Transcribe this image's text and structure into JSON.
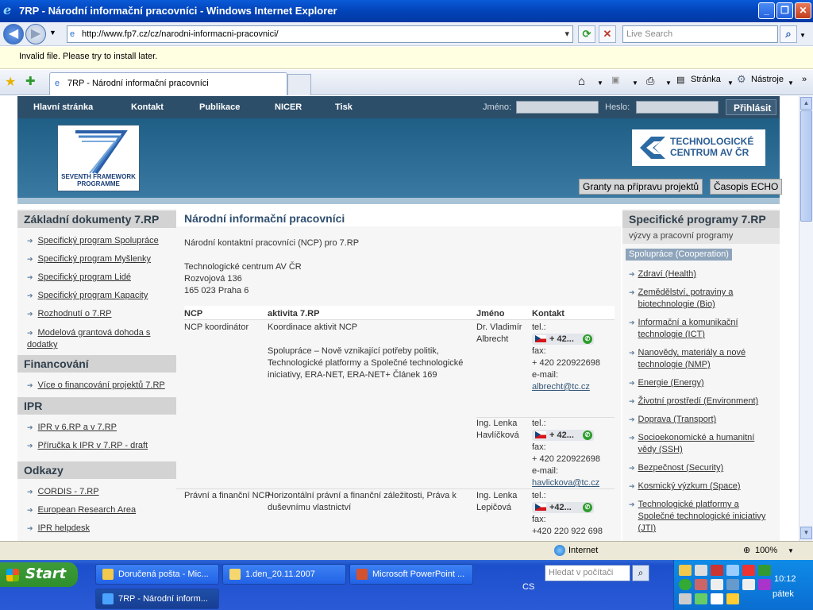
{
  "window": {
    "title": "7RP - Národní informační pracovníci - Windows Internet Explorer"
  },
  "browser": {
    "url": "http://www.fp7.cz/cz/narodni-informacni-pracovnici/",
    "search_placeholder": "Live Search",
    "info_bar": "Invalid file. Please try to install later.",
    "tab_title": "7RP - Národní informační pracovníci",
    "toolbar": {
      "page": "Stránka",
      "tools": "Nástroje"
    }
  },
  "page": {
    "nav": [
      "Hlavní stránka",
      "Kontakt",
      "Publikace",
      "NICER",
      "Tisk"
    ],
    "login": {
      "name_label": "Jméno:",
      "pass_label": "Heslo:",
      "submit": "Přihlásit"
    },
    "logo_left": {
      "line1": "SEVENTH FRAMEWORK",
      "line2": "PROGRAMME"
    },
    "logo_right": {
      "line1": "TECHNOLOGICKÉ",
      "line2": "CENTRUM AV ČR"
    },
    "header_buttons": [
      "Granty na přípravu projektů",
      "Časopis ECHO"
    ],
    "left": {
      "sections": [
        {
          "title": "Základní dokumenty 7.RP",
          "links": [
            "Specifický program Spolupráce",
            "Specifický program Myšlenky",
            "Specifický program Lidé",
            "Specifický program Kapacity",
            "Rozhodnutí o 7.RP",
            "Modelová grantová dohoda s dodatky"
          ]
        },
        {
          "title": "Financování",
          "links": [
            "Více o financování projektů 7.RP"
          ]
        },
        {
          "title": "IPR",
          "links": [
            "IPR v 6.RP a v 7.RP",
            "Příručka k IPR v 7.RP - draft"
          ]
        },
        {
          "title": "Odkazy",
          "links": [
            "CORDIS - 7.RP",
            "European Research Area",
            "IPR helpdesk"
          ]
        }
      ]
    },
    "main": {
      "title": "Národní informační pracovníci",
      "intro": "Národní kontaktní pracovníci (NCP) pro 7.RP",
      "address": [
        "Technologické centrum AV ČR",
        "Rozvojová 136",
        "165 023 Praha 6"
      ],
      "table_headers": [
        "NCP",
        "aktivita 7.RP",
        "Jméno",
        "Kontakt"
      ],
      "rows": [
        {
          "ncp": "NCP koordinátor",
          "activity": "Koordinace aktivit NCP",
          "activity2": "Spolupráce – Nově vznikající potřeby politik, Technologické platformy a Společné technologické iniciativy, ERA-NET, ERA-NET+ Článek 169",
          "name": "Dr. Vladimír Albrecht",
          "tel_label": "tel.:",
          "tel": "+ 42...",
          "fax_label": "fax:",
          "fax": "+ 420 220922698",
          "email_label": "e-mail:",
          "email": "albrecht@tc.cz"
        },
        {
          "ncp": "",
          "activity": "",
          "activity2": "",
          "name": "Ing. Lenka Havlíčková",
          "tel_label": "tel.:",
          "tel": "+ 42...",
          "fax_label": "fax:",
          "fax": "+ 420 220922698",
          "email_label": "e-mail:",
          "email": "havlickova@tc.cz"
        },
        {
          "ncp": "Právní a finanční NCP",
          "activity": "Horizontální právní a finanční záležitosti, Práva k duševnímu vlastnictví",
          "activity2": "",
          "name": "Ing. Lenka Lepičová",
          "tel_label": "tel.:",
          "tel": "+42...",
          "fax_label": "fax:",
          "fax": "+420 220 922 698",
          "email_label": "",
          "email": ""
        }
      ]
    },
    "right": {
      "title": "Specifické programy 7.RP",
      "subtitle": "výzvy a pracovní programy",
      "badge": "Spolupráce (Cooperation)",
      "links": [
        "Zdraví (Health)",
        "Zemědělství, potraviny a biotechnologie (Bio)",
        "Informační a komunikační technologie (ICT)",
        "Nanovědy, materiály a nové technologie (NMP)",
        "Energie (Energy)",
        "Životní prostředí (Environment)",
        "Doprava (Transport)",
        "Socioekonomické a humanitní vědy (SSH)",
        "Bezpečnost (Security)",
        "Kosmický výzkum (Space)",
        "Technologické platformy a Společné technologické iniciativy (JTI)"
      ]
    }
  },
  "statusbar": {
    "zone": "Internet",
    "zoom": "100%"
  },
  "taskbar": {
    "start": "Start",
    "items": [
      "Doručená pošta - Mic...",
      "1.den_20.11.2007",
      "Microsoft PowerPoint ...",
      "7RP - Národní inform..."
    ],
    "search_placeholder": "Hledat v počítači",
    "lang": "CS",
    "time": "10:12",
    "day": "pátek"
  }
}
